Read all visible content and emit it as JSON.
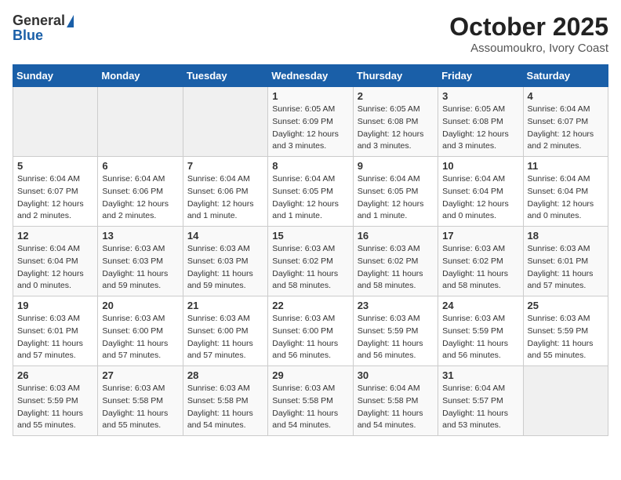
{
  "header": {
    "logo_general": "General",
    "logo_blue": "Blue",
    "month_title": "October 2025",
    "location": "Assoumoukro, Ivory Coast"
  },
  "weekdays": [
    "Sunday",
    "Monday",
    "Tuesday",
    "Wednesday",
    "Thursday",
    "Friday",
    "Saturday"
  ],
  "weeks": [
    [
      {
        "day": "",
        "info": ""
      },
      {
        "day": "",
        "info": ""
      },
      {
        "day": "",
        "info": ""
      },
      {
        "day": "1",
        "info": "Sunrise: 6:05 AM\nSunset: 6:09 PM\nDaylight: 12 hours\nand 3 minutes."
      },
      {
        "day": "2",
        "info": "Sunrise: 6:05 AM\nSunset: 6:08 PM\nDaylight: 12 hours\nand 3 minutes."
      },
      {
        "day": "3",
        "info": "Sunrise: 6:05 AM\nSunset: 6:08 PM\nDaylight: 12 hours\nand 3 minutes."
      },
      {
        "day": "4",
        "info": "Sunrise: 6:04 AM\nSunset: 6:07 PM\nDaylight: 12 hours\nand 2 minutes."
      }
    ],
    [
      {
        "day": "5",
        "info": "Sunrise: 6:04 AM\nSunset: 6:07 PM\nDaylight: 12 hours\nand 2 minutes."
      },
      {
        "day": "6",
        "info": "Sunrise: 6:04 AM\nSunset: 6:06 PM\nDaylight: 12 hours\nand 2 minutes."
      },
      {
        "day": "7",
        "info": "Sunrise: 6:04 AM\nSunset: 6:06 PM\nDaylight: 12 hours\nand 1 minute."
      },
      {
        "day": "8",
        "info": "Sunrise: 6:04 AM\nSunset: 6:05 PM\nDaylight: 12 hours\nand 1 minute."
      },
      {
        "day": "9",
        "info": "Sunrise: 6:04 AM\nSunset: 6:05 PM\nDaylight: 12 hours\nand 1 minute."
      },
      {
        "day": "10",
        "info": "Sunrise: 6:04 AM\nSunset: 6:04 PM\nDaylight: 12 hours\nand 0 minutes."
      },
      {
        "day": "11",
        "info": "Sunrise: 6:04 AM\nSunset: 6:04 PM\nDaylight: 12 hours\nand 0 minutes."
      }
    ],
    [
      {
        "day": "12",
        "info": "Sunrise: 6:04 AM\nSunset: 6:04 PM\nDaylight: 12 hours\nand 0 minutes."
      },
      {
        "day": "13",
        "info": "Sunrise: 6:03 AM\nSunset: 6:03 PM\nDaylight: 11 hours\nand 59 minutes."
      },
      {
        "day": "14",
        "info": "Sunrise: 6:03 AM\nSunset: 6:03 PM\nDaylight: 11 hours\nand 59 minutes."
      },
      {
        "day": "15",
        "info": "Sunrise: 6:03 AM\nSunset: 6:02 PM\nDaylight: 11 hours\nand 58 minutes."
      },
      {
        "day": "16",
        "info": "Sunrise: 6:03 AM\nSunset: 6:02 PM\nDaylight: 11 hours\nand 58 minutes."
      },
      {
        "day": "17",
        "info": "Sunrise: 6:03 AM\nSunset: 6:02 PM\nDaylight: 11 hours\nand 58 minutes."
      },
      {
        "day": "18",
        "info": "Sunrise: 6:03 AM\nSunset: 6:01 PM\nDaylight: 11 hours\nand 57 minutes."
      }
    ],
    [
      {
        "day": "19",
        "info": "Sunrise: 6:03 AM\nSunset: 6:01 PM\nDaylight: 11 hours\nand 57 minutes."
      },
      {
        "day": "20",
        "info": "Sunrise: 6:03 AM\nSunset: 6:00 PM\nDaylight: 11 hours\nand 57 minutes."
      },
      {
        "day": "21",
        "info": "Sunrise: 6:03 AM\nSunset: 6:00 PM\nDaylight: 11 hours\nand 57 minutes."
      },
      {
        "day": "22",
        "info": "Sunrise: 6:03 AM\nSunset: 6:00 PM\nDaylight: 11 hours\nand 56 minutes."
      },
      {
        "day": "23",
        "info": "Sunrise: 6:03 AM\nSunset: 5:59 PM\nDaylight: 11 hours\nand 56 minutes."
      },
      {
        "day": "24",
        "info": "Sunrise: 6:03 AM\nSunset: 5:59 PM\nDaylight: 11 hours\nand 56 minutes."
      },
      {
        "day": "25",
        "info": "Sunrise: 6:03 AM\nSunset: 5:59 PM\nDaylight: 11 hours\nand 55 minutes."
      }
    ],
    [
      {
        "day": "26",
        "info": "Sunrise: 6:03 AM\nSunset: 5:59 PM\nDaylight: 11 hours\nand 55 minutes."
      },
      {
        "day": "27",
        "info": "Sunrise: 6:03 AM\nSunset: 5:58 PM\nDaylight: 11 hours\nand 55 minutes."
      },
      {
        "day": "28",
        "info": "Sunrise: 6:03 AM\nSunset: 5:58 PM\nDaylight: 11 hours\nand 54 minutes."
      },
      {
        "day": "29",
        "info": "Sunrise: 6:03 AM\nSunset: 5:58 PM\nDaylight: 11 hours\nand 54 minutes."
      },
      {
        "day": "30",
        "info": "Sunrise: 6:04 AM\nSunset: 5:58 PM\nDaylight: 11 hours\nand 54 minutes."
      },
      {
        "day": "31",
        "info": "Sunrise: 6:04 AM\nSunset: 5:57 PM\nDaylight: 11 hours\nand 53 minutes."
      },
      {
        "day": "",
        "info": ""
      }
    ]
  ]
}
